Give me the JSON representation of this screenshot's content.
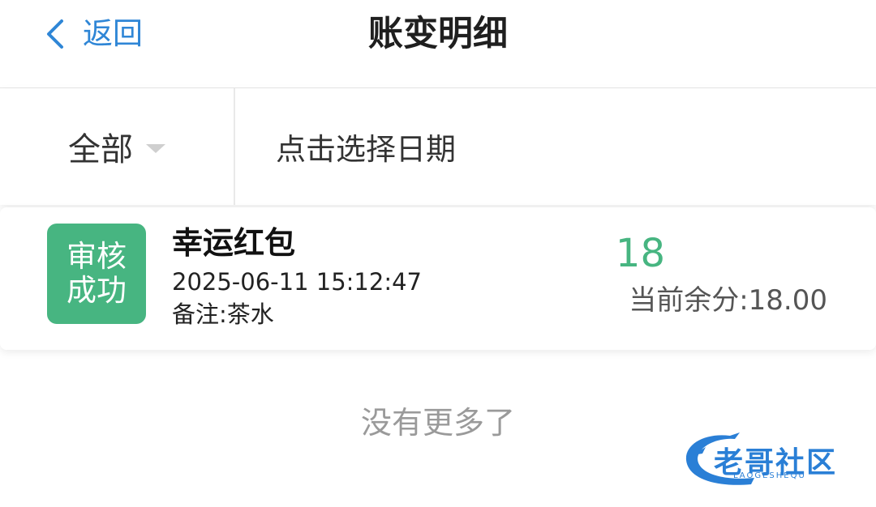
{
  "header": {
    "back_label": "返回",
    "title": "账变明细"
  },
  "filter": {
    "type_label": "全部",
    "date_placeholder": "点击选择日期"
  },
  "records": [
    {
      "status_line1": "审核",
      "status_line2": "成功",
      "title": "幸运红包",
      "time": "2025-06-11 15:12:47",
      "note": "备注:茶水",
      "amount": "18",
      "balance": "当前余分:18.00"
    }
  ],
  "footer": {
    "no_more": "没有更多了"
  },
  "watermark": {
    "text": "老哥社区",
    "subtext": "LAOGESHEQU"
  },
  "colors": {
    "accent_blue": "#2f86d6",
    "success_green": "#47b581",
    "text_dark": "#333333",
    "muted": "#9a9a9a"
  },
  "icons": {
    "back": "chevron-left-icon",
    "dropdown": "caret-down-icon",
    "logo": "dragon-logo-icon"
  }
}
